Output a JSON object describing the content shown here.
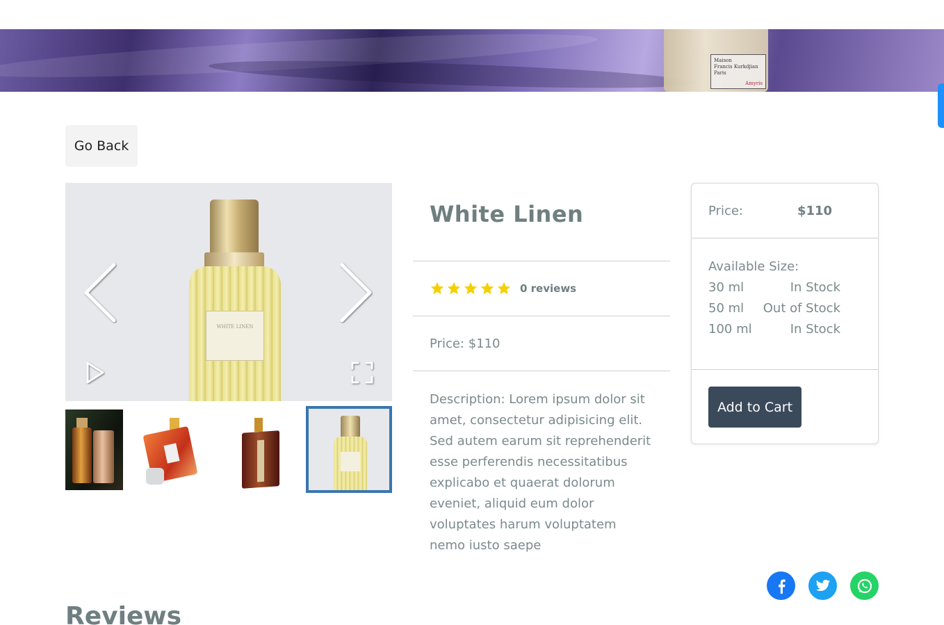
{
  "banner": {
    "bottle_label_line1": "Maison",
    "bottle_label_line2": "Francis Kurkdjian",
    "bottle_label_line3": "Paris",
    "bottle_label_accent": "Amyris"
  },
  "nav": {
    "go_back_label": "Go Back"
  },
  "gallery": {
    "active_thumbnail": 4,
    "thumbnails": [
      "thumbnail-1",
      "thumbnail-2",
      "thumbnail-3",
      "thumbnail-4"
    ],
    "main_label_text": "WHITE LINEN"
  },
  "product": {
    "title": "White Linen",
    "rating": 5,
    "reviews_text": "0 reviews",
    "price_text": "Price: $110",
    "description": "Description: Lorem ipsum dolor sit amet, consectetur adipisicing elit. Sed autem earum sit reprehenderit esse perferendis necessitatibus explicabo et quaerat dolorum eveniet, aliquid eum dolor voluptates harum voluptatem nemo iusto saepe"
  },
  "purchase_card": {
    "price_label": "Price:",
    "price_value": "$110",
    "sizes_heading": "Available Size:",
    "sizes": [
      {
        "size": "30 ml",
        "status": "In Stock"
      },
      {
        "size": "50 ml",
        "status": "Out of Stock"
      },
      {
        "size": "100 ml",
        "status": "In Stock"
      }
    ],
    "add_to_cart_label": "Add to Cart"
  },
  "share": {
    "icons": [
      "facebook-icon",
      "twitter-icon",
      "whatsapp-icon"
    ]
  },
  "reviews": {
    "heading": "Reviews"
  },
  "colors": {
    "accent_dark": "#3b4a5a",
    "star": "#f5d000",
    "facebook": "#1877f2",
    "twitter": "#1da1f2",
    "whatsapp": "#25d366",
    "thumb_active_border": "#3a76b0",
    "side_tab": "#1e90ff"
  }
}
